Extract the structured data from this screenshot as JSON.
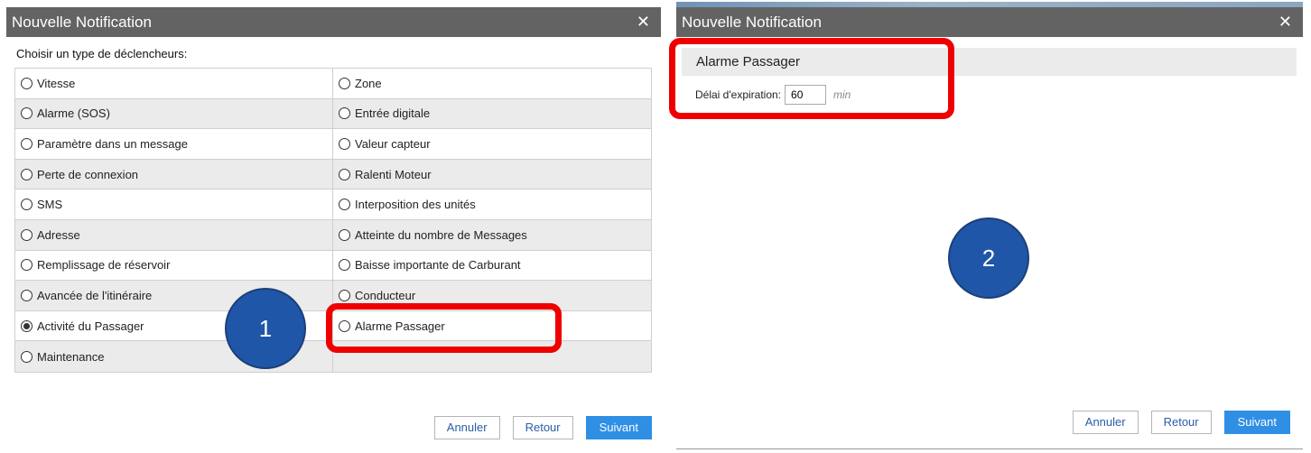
{
  "left_dialog": {
    "title": "Nouvelle Notification",
    "close": "✕",
    "prompt": "Choisir un type de déclencheurs:",
    "rows": [
      {
        "left": "Vitesse",
        "right": "Zone"
      },
      {
        "left": "Alarme (SOS)",
        "right": "Entrée digitale"
      },
      {
        "left": "Paramètre dans un message",
        "right": "Valeur capteur"
      },
      {
        "left": "Perte de connexion",
        "right": "Ralenti Moteur"
      },
      {
        "left": "SMS",
        "right": "Interposition des unités"
      },
      {
        "left": "Adresse",
        "right": "Atteinte du nombre de Messages"
      },
      {
        "left": "Remplissage de réservoir",
        "right": "Baisse importante de Carburant"
      },
      {
        "left": "Avancée de l'itinéraire",
        "right": "Conducteur"
      },
      {
        "left": "Activité du Passager",
        "right": "Alarme Passager"
      },
      {
        "left": "Maintenance",
        "right": ""
      }
    ],
    "selected": "Activité du Passager",
    "buttons": {
      "cancel": "Annuler",
      "back": "Retour",
      "next": "Suivant"
    },
    "marker": "1"
  },
  "right_dialog": {
    "title": "Nouvelle Notification",
    "close": "✕",
    "section": "Alarme Passager",
    "field_label": "Délai d'expiration:",
    "field_value": "60",
    "field_unit": "min",
    "buttons": {
      "cancel": "Annuler",
      "back": "Retour",
      "next": "Suivant"
    },
    "marker": "2"
  },
  "colors": {
    "titlebar": "#636363",
    "primary_button": "#2f8fe4",
    "highlight": "#ee0000",
    "marker": "#1f56a8"
  }
}
